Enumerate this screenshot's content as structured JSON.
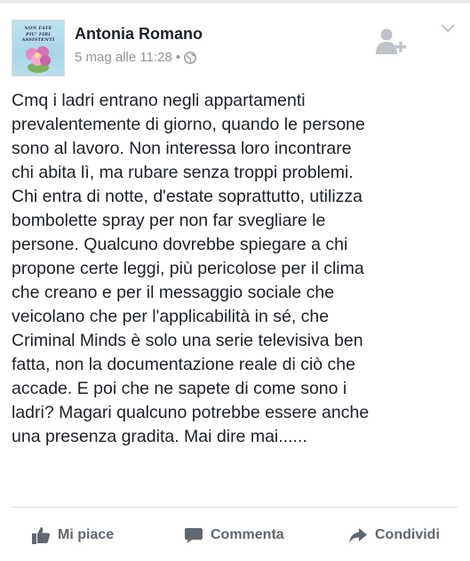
{
  "post": {
    "author": "Antonia Romano",
    "avatar_caption_line1": "NON FATE",
    "avatar_caption_line2": "PIU' FIRI ASSISTENTI",
    "timestamp": "5 mag alle 11:28",
    "separator": "•",
    "privacy_icon": "globe-icon",
    "body": "Cmq i ladri entrano negli appartamenti\nprevalentemente di giorno, quando le persone\nsono al lavoro. Non interessa loro incontrare\nchi abita lì, ma rubare senza troppi problemi.\nChi entra di notte, d'estate soprattutto, utilizza\nbombolette spray per non far svegliare le\npersone. Qualcuno dovrebbe spiegare a chi\npropone certe leggi, più pericolose per il clima\nche creano e per il messaggio sociale che\nveicolano che per l'applicabilità in sé, che\nCriminal Minds è solo una serie televisiva ben\nfatta, non la documentazione reale di ciò che\naccade. E poi che ne sapete di come sono i\nladri? Magari qualcuno potrebbe essere anche\nuna presenza gradita. Mai dire mai......"
  },
  "actions": {
    "like": "Mi piace",
    "comment": "Commenta",
    "share": "Condividi"
  },
  "colors": {
    "text": "#1d2129",
    "meta": "#90949c",
    "action": "#606770",
    "icon_gray": "#bec3c9",
    "divider": "#dddfe2"
  }
}
